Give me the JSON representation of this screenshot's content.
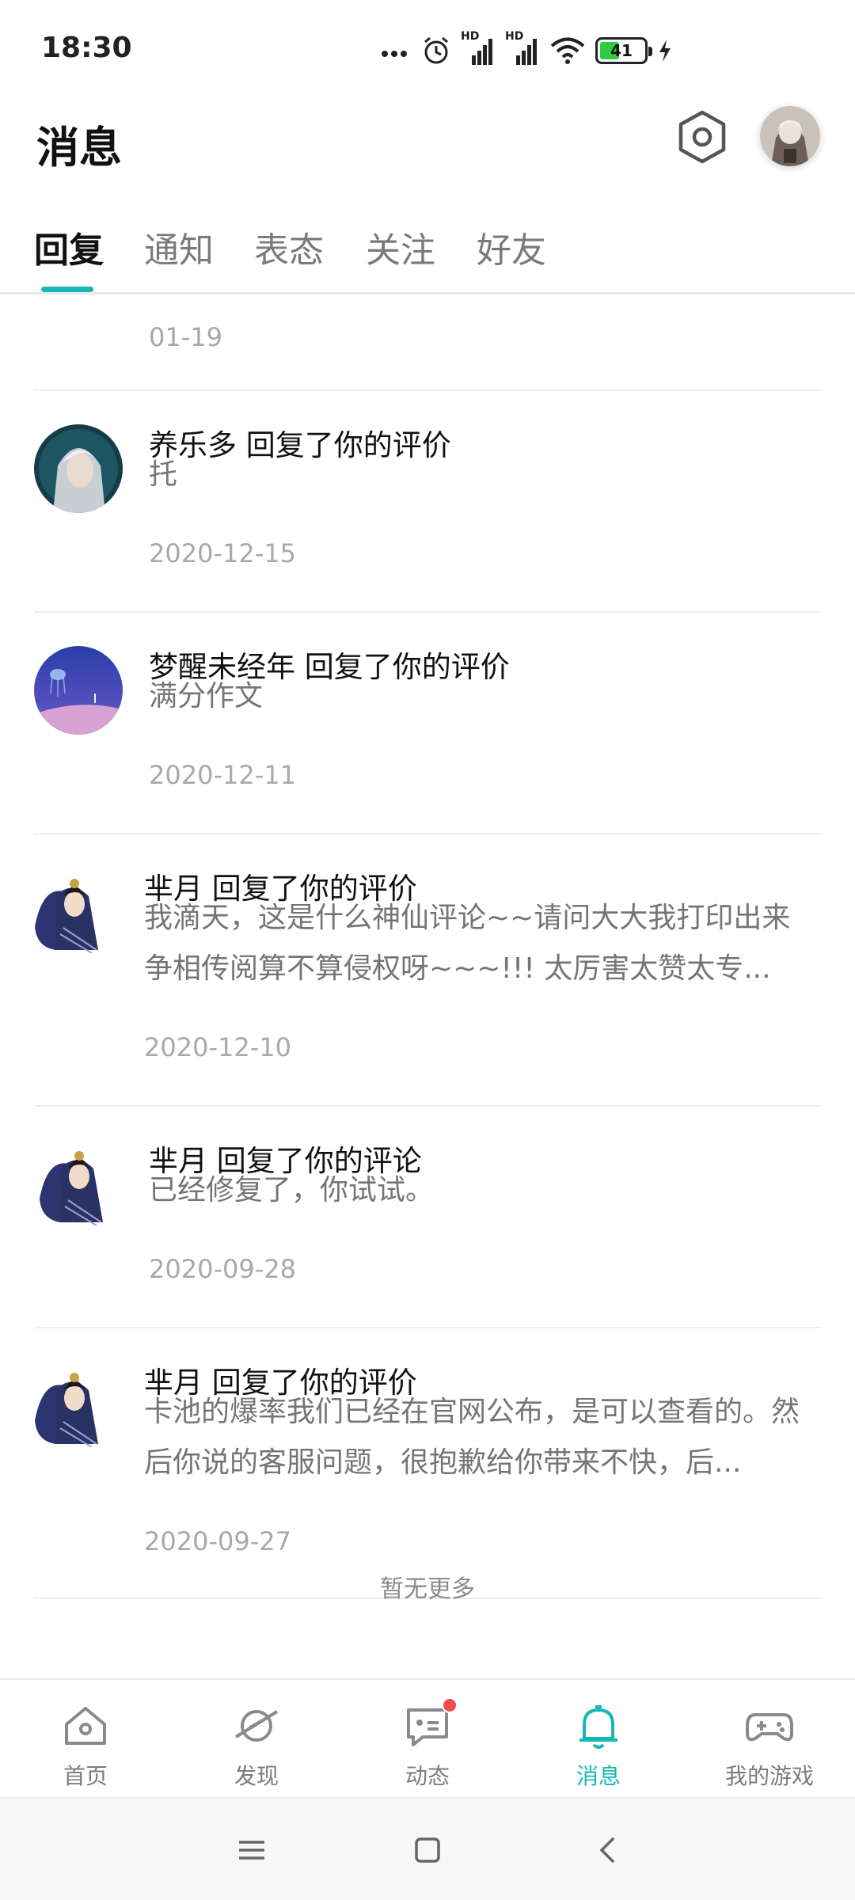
{
  "status_bar": {
    "time": "18:30",
    "battery": "41",
    "network_labels": [
      "HD",
      "HD"
    ]
  },
  "header": {
    "title": "消息"
  },
  "tabs": [
    {
      "label": "回复",
      "active": true
    },
    {
      "label": "通知",
      "active": false
    },
    {
      "label": "表态",
      "active": false
    },
    {
      "label": "关注",
      "active": false
    },
    {
      "label": "好友",
      "active": false
    }
  ],
  "list": {
    "top_date": "01-19",
    "items": [
      {
        "title": "养乐多 回复了你的评价",
        "body": "托",
        "date": "2020-12-15",
        "avatar": "avatar-silver-hair"
      },
      {
        "title": "梦醒未经年 回复了你的评价",
        "body": "满分作文",
        "date": "2020-12-11",
        "avatar": "avatar-jellyfish-scene"
      },
      {
        "title": "芈月 回复了你的评价",
        "body": "我滴天，这是什么神仙评论~~请问大大我打印出来争相传阅算不算侵权呀~~~!!! 太厉害太赞太专...",
        "date": "2020-12-10",
        "avatar": "avatar-miyue"
      },
      {
        "title": "芈月 回复了你的评论",
        "body": "已经修复了，你试试。",
        "date": "2020-09-28",
        "avatar": "avatar-miyue"
      },
      {
        "title": "芈月 回复了你的评价",
        "body": "卡池的爆率我们已经在官网公布，是可以查看的。然后你说的客服问题，很抱歉给你带来不快，后...",
        "date": "2020-09-27",
        "avatar": "avatar-miyue"
      }
    ],
    "footer": "暂无更多"
  },
  "bottom_nav": [
    {
      "label": "首页",
      "icon": "home-icon",
      "active": false
    },
    {
      "label": "发现",
      "icon": "discover-planet-icon",
      "active": false
    },
    {
      "label": "动态",
      "icon": "chat-bubble-icon",
      "active": false,
      "badge": true
    },
    {
      "label": "消息",
      "icon": "bell-icon",
      "active": true
    },
    {
      "label": "我的游戏",
      "icon": "gamepad-icon",
      "active": false
    }
  ],
  "colors": {
    "accent": "#16b7b7",
    "badge": "#f24d4d"
  }
}
